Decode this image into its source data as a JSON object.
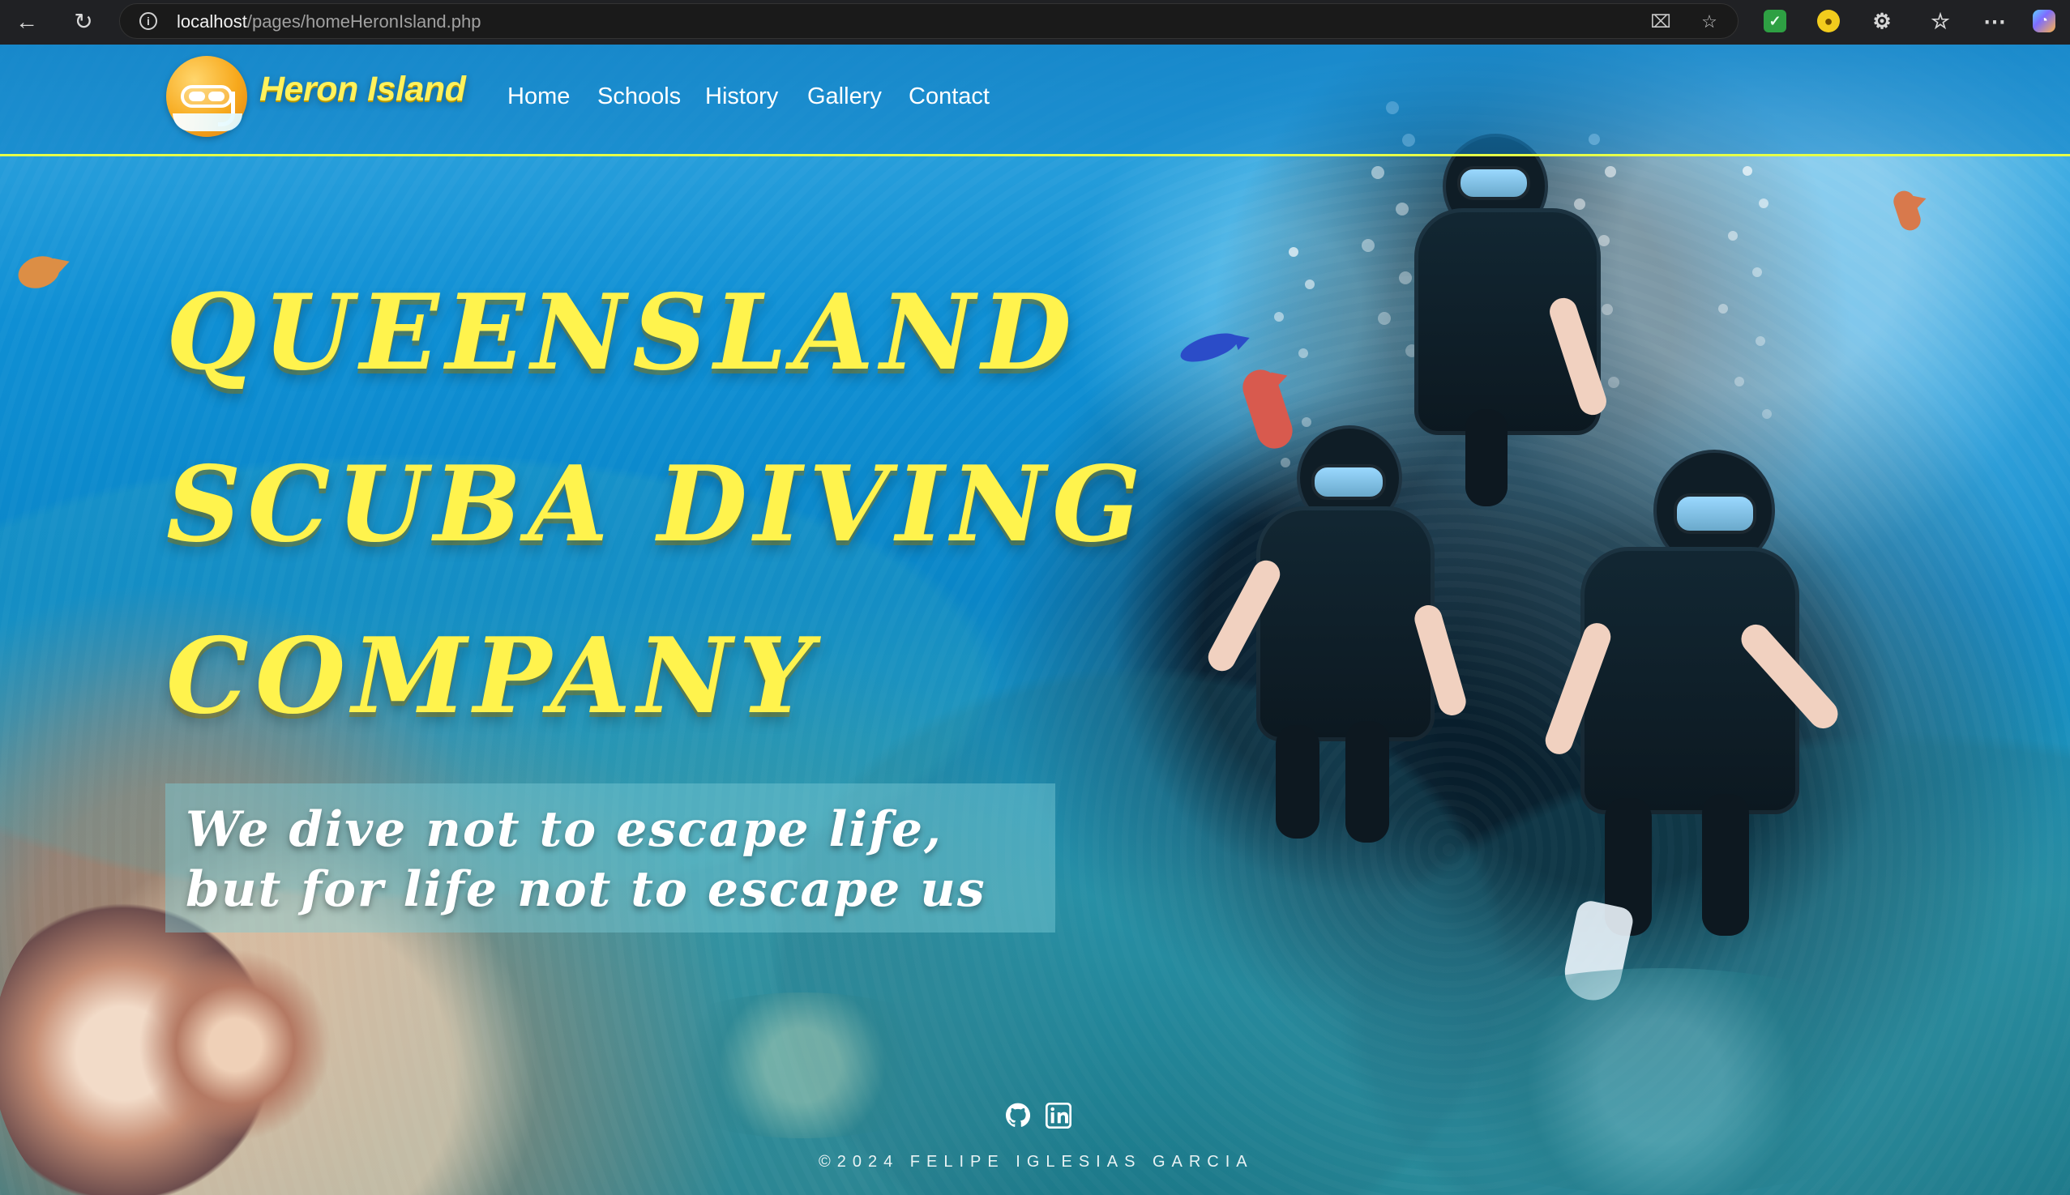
{
  "browser": {
    "url_host": "localhost",
    "url_path": "/pages/homeHeronIsland.php",
    "icons": {
      "back": "back-arrow-icon",
      "reload": "reload-icon",
      "info": "info-icon",
      "install": "install-app-icon",
      "favorite": "favorite-star-icon",
      "extension_1": "green-check-extension-icon",
      "extension_2": "yellow-extension-icon",
      "extensions": "puzzle-icon",
      "favorites_bar": "favorites-icon",
      "more": "more-icon",
      "copilot": "copilot-icon"
    }
  },
  "site": {
    "brand": "Heron Island",
    "nav": [
      "Home",
      "Schools",
      "History",
      "Gallery",
      "Contact"
    ],
    "hero_lines": [
      "QUEENSLAND",
      "SCUBA DIVING",
      "COMPANY"
    ],
    "quote_lines": [
      "We dive not to escape life,",
      "but for life not to escape us"
    ],
    "footer": "©2024 FELIPE IGLESIAS GARCIA",
    "accent": "#fff34d",
    "navbar_line": "#e6ff49"
  }
}
